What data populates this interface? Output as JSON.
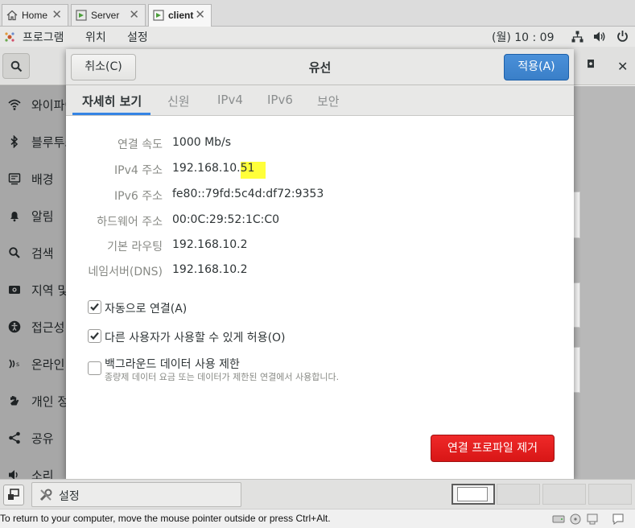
{
  "vm_tabs": [
    {
      "label": "Home",
      "icon": "home-icon",
      "active": false
    },
    {
      "label": "Server",
      "icon": "vm-icon",
      "active": false
    },
    {
      "label": "client",
      "icon": "vm-icon",
      "active": true
    }
  ],
  "topbar": {
    "menus": [
      "프로그램",
      "위치",
      "설정"
    ],
    "clock": "(월) 10 : 09",
    "status_icons": [
      "network-icon",
      "volume-icon",
      "power-icon"
    ]
  },
  "settings_sidebar": [
    {
      "label": "와이파이",
      "icon": "wifi-icon"
    },
    {
      "label": "블루투스",
      "icon": "bluetooth-icon"
    },
    {
      "label": "배경",
      "icon": "background-icon"
    },
    {
      "label": "알림",
      "icon": "bell-icon"
    },
    {
      "label": "검색",
      "icon": "search-icon"
    },
    {
      "label": "지역 및 언어",
      "icon": "region-icon"
    },
    {
      "label": "접근성",
      "icon": "accessibility-icon"
    },
    {
      "label": "온라인 계정",
      "icon": "online-accounts-icon"
    },
    {
      "label": "개인 정보",
      "icon": "privacy-hand-icon"
    },
    {
      "label": "공유",
      "icon": "share-icon"
    },
    {
      "label": "소리",
      "icon": "sound-icon"
    }
  ],
  "dialog": {
    "title": "유선",
    "cancel_label": "취소(C)",
    "apply_label": "적용(A)",
    "tabs": [
      {
        "label": "자세히 보기",
        "active": true
      },
      {
        "label": "신원",
        "active": false
      },
      {
        "label": "IPv4",
        "active": false
      },
      {
        "label": "IPv6",
        "active": false
      },
      {
        "label": "보안",
        "active": false
      }
    ],
    "details": [
      {
        "label": "연결 속도",
        "value": "1000 Mb/s"
      },
      {
        "label": "IPv4 주소",
        "value_prefix": "192.168.10.",
        "value_highlight": "51"
      },
      {
        "label": "IPv6 주소",
        "value": "fe80::79fd:5c4d:df72:9353"
      },
      {
        "label": "하드웨어 주소",
        "value": "00:0C:29:52:1C:C0"
      },
      {
        "label": "기본 라우팅",
        "value": "192.168.10.2"
      },
      {
        "label": "네임서버(DNS)",
        "value": "192.168.10.2"
      }
    ],
    "highlight_color": "#ffff3a",
    "options": [
      {
        "label": "자동으로 연결(A)",
        "checked": true
      },
      {
        "label": "다른 사용자가 사용할 수 있게 허용(O)",
        "checked": true
      },
      {
        "label": "백그라운드 데이터 사용 제한",
        "sublabel": "종량제 데이터 요금 또는 데이터가 제한된 연결에서 사용합니다.",
        "checked": false
      }
    ],
    "remove_label": "연결 프로파일 제거"
  },
  "taskbar": {
    "task_label": "설정",
    "workspaces": 4,
    "active_workspace": 1
  },
  "statusbar": {
    "text": "To return to your computer, move the mouse pointer outside or press Ctrl+Alt."
  },
  "colors": {
    "accent": "#3584e4",
    "apply": "#3a7fc8",
    "destructive": "#e01b24"
  }
}
